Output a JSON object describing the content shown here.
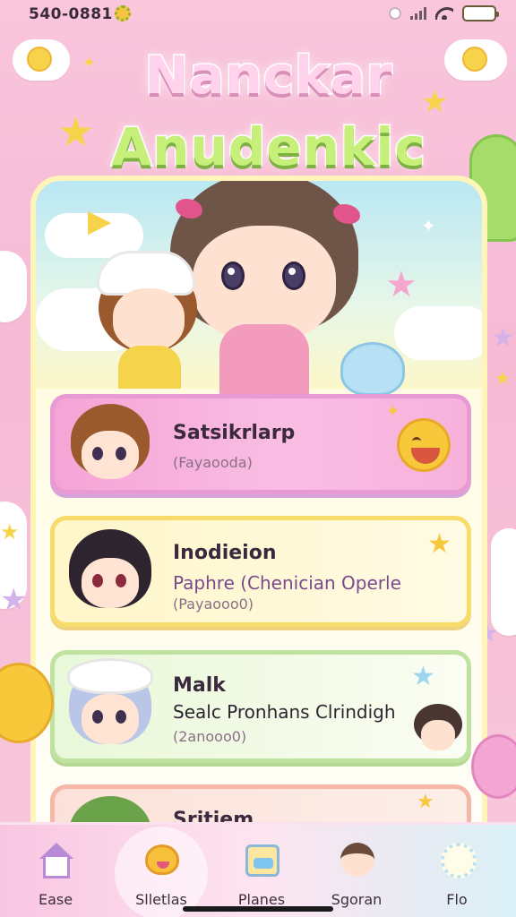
{
  "status_bar": {
    "time": "540-0881",
    "battery_level": 0.85,
    "signal_bars": 4
  },
  "title": {
    "line1": "Nanckar",
    "line2": "Anudenkic"
  },
  "list": [
    {
      "title": "Satsikrlarp",
      "subtitle": "",
      "note": "(Fayaooda)",
      "accent": "#f6a4d6"
    },
    {
      "title": "Inodieion",
      "subtitle": "Paphre (Chenician Operle",
      "note": "(Payaooo0)",
      "accent": "#fff6c9"
    },
    {
      "title": "Malk",
      "subtitle": "Sealc Pronhans Clrindigh",
      "note": "(2anooo0)",
      "accent": "#e9f8d9"
    },
    {
      "title": "Sritiem",
      "subtitle": "",
      "note": "",
      "accent": "#fbe1d9"
    }
  ],
  "tabs": [
    {
      "label": "Ease",
      "icon": "home-icon",
      "active": false
    },
    {
      "label": "Slletlas",
      "icon": "heart-face-icon",
      "active": true
    },
    {
      "label": "Planes",
      "icon": "toy-box-icon",
      "active": false
    },
    {
      "label": "Sgoran",
      "icon": "kid-avatar-icon",
      "active": false
    },
    {
      "label": "Flo",
      "icon": "sheep-icon",
      "active": false
    }
  ],
  "colors": {
    "background": "#f6b9d4",
    "card_border": "#fff5b8",
    "text_dark": "#3b2a3e"
  }
}
